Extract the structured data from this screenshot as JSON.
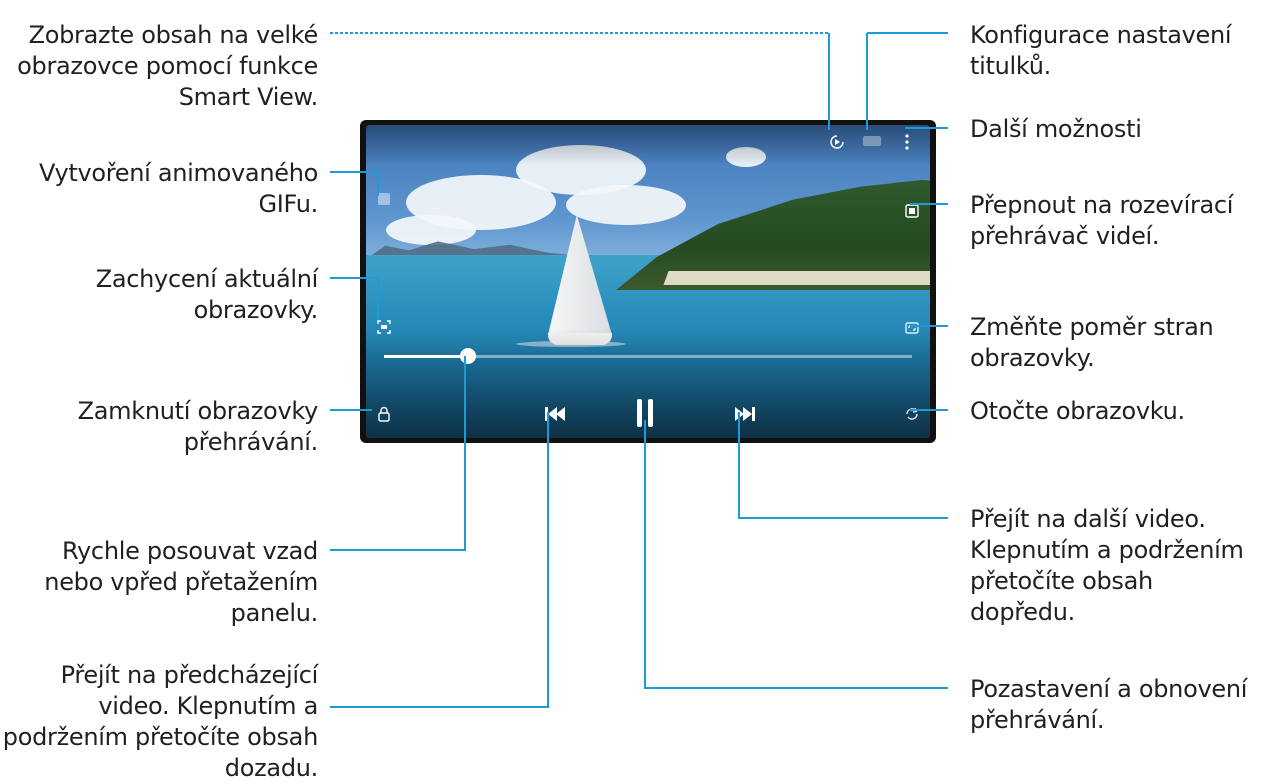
{
  "callouts": {
    "smart_view": "Zobrazte obsah na velké\nobrazovce pomocí funkce\nSmart View.",
    "subtitles": "Konfigurace nastavení\ntitulků.",
    "more_options": "Další možnosti",
    "gif": "Vytvoření animovaného\nGIFu.",
    "popup_player": "Přepnout na rozevírací\npřehrávač videí.",
    "capture": "Zachycení aktuální\nobrazovky.",
    "ratio": "Změňte poměr stran\nobrazovky.",
    "lock": "Zamknutí obrazovky\npřehrávání.",
    "rotate": "Otočte obrazovku.",
    "next": "Přejít na další video.\nKlepnutím a podržením\npřetočíte obsah dopředu.",
    "seek": "Rychle posouvat vzad\nnebo vpřed přetažením\npanelu.",
    "previous": "Přejít na předcházející\nvideo. Klepnutím a\npodržením přetočíte obsah\ndozadu.",
    "pause": "Pozastavení a obnovení\npřehrávání."
  },
  "player": {
    "progress_fraction": 0.16
  },
  "icons": {
    "smart_view": "smart-view-icon",
    "subtitles": "subtitles-icon",
    "more": "more-vertical-icon",
    "gif": "gif-icon",
    "popup": "popup-player-icon",
    "capture": "capture-icon",
    "ratio": "aspect-ratio-icon",
    "lock": "lock-icon",
    "rotate": "rotate-icon",
    "previous": "skip-previous-icon",
    "pause": "pause-icon",
    "next": "skip-next-icon"
  },
  "colors": {
    "leader": "#1e9ad6"
  }
}
